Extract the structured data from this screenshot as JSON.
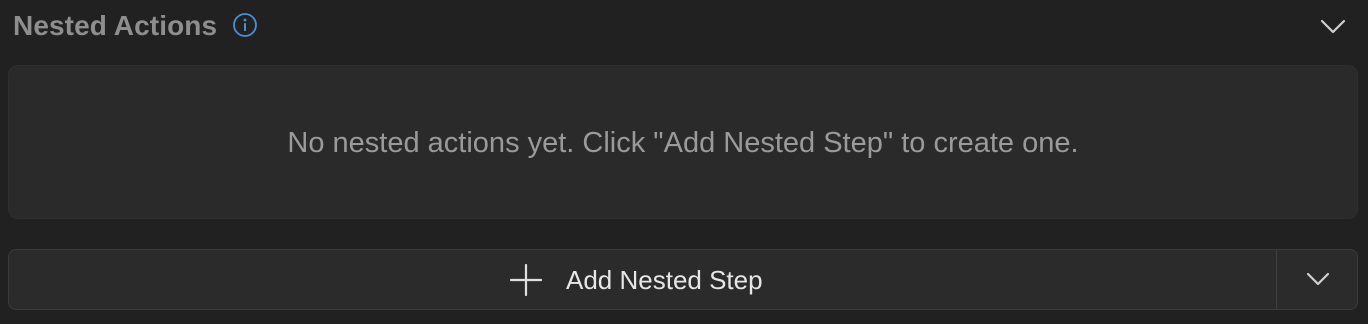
{
  "section": {
    "title": "Nested Actions",
    "info_icon": "info-icon",
    "collapse_icon": "chevron-down-icon"
  },
  "empty_state": {
    "message": "No nested actions yet. Click \"Add Nested Step\" to create one."
  },
  "add_step": {
    "label": "Add Nested Step",
    "icon": "plus-icon",
    "dropdown_icon": "chevron-down-icon"
  },
  "colors": {
    "background": "#212121",
    "panel": "#2a2a2a",
    "title": "#8e8e8e",
    "info_accent": "#4a8fd8",
    "button_text": "#e6e6e6",
    "muted_text": "#9a9a9a"
  }
}
